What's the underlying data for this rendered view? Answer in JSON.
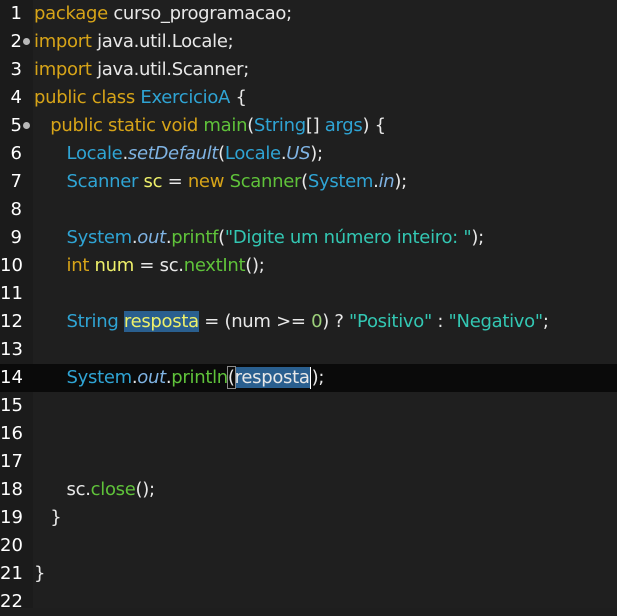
{
  "editor": {
    "lines": [
      {
        "n": "1",
        "segments": [
          {
            "c": "kw",
            "t": "package "
          },
          {
            "c": "plain",
            "t": "curso_programacao;"
          }
        ]
      },
      {
        "n": "2",
        "fold": true,
        "segments": [
          {
            "c": "kw",
            "t": "import "
          },
          {
            "c": "plain",
            "t": "java.util.Locale;"
          }
        ]
      },
      {
        "n": "3",
        "segments": [
          {
            "c": "kw",
            "t": "import "
          },
          {
            "c": "plain",
            "t": "java.util.Scanner;"
          }
        ]
      },
      {
        "n": "4",
        "segments": [
          {
            "c": "kw",
            "t": "public class "
          },
          {
            "c": "ty",
            "t": "ExercicioA"
          },
          {
            "c": "plain",
            "t": " {"
          }
        ]
      },
      {
        "n": "5",
        "fold": true,
        "segments": [
          {
            "c": "plain",
            "t": "   "
          },
          {
            "c": "kw",
            "t": "public static void "
          },
          {
            "c": "fn",
            "t": "main"
          },
          {
            "c": "plain",
            "t": "("
          },
          {
            "c": "ty",
            "t": "String"
          },
          {
            "c": "plain",
            "t": "[] "
          },
          {
            "c": "ty",
            "t": "args"
          },
          {
            "c": "plain",
            "t": ") {"
          }
        ]
      },
      {
        "n": "6",
        "segments": [
          {
            "c": "plain",
            "t": "      "
          },
          {
            "c": "ty",
            "t": "Locale"
          },
          {
            "c": "plain",
            "t": "."
          },
          {
            "c": "fld",
            "t": "setDefault"
          },
          {
            "c": "plain",
            "t": "("
          },
          {
            "c": "ty",
            "t": "Locale"
          },
          {
            "c": "plain",
            "t": "."
          },
          {
            "c": "fld",
            "t": "US"
          },
          {
            "c": "plain",
            "t": ");"
          }
        ]
      },
      {
        "n": "7",
        "segments": [
          {
            "c": "plain",
            "t": "      "
          },
          {
            "c": "ty",
            "t": "Scanner "
          },
          {
            "c": "var",
            "t": "sc"
          },
          {
            "c": "plain",
            "t": " = "
          },
          {
            "c": "kw",
            "t": "new "
          },
          {
            "c": "fn",
            "t": "Scanner"
          },
          {
            "c": "plain",
            "t": "("
          },
          {
            "c": "ty",
            "t": "System"
          },
          {
            "c": "plain",
            "t": "."
          },
          {
            "c": "fld",
            "t": "in"
          },
          {
            "c": "plain",
            "t": ");"
          }
        ]
      },
      {
        "n": "8",
        "segments": []
      },
      {
        "n": "9",
        "segments": [
          {
            "c": "plain",
            "t": "      "
          },
          {
            "c": "ty",
            "t": "System"
          },
          {
            "c": "plain",
            "t": "."
          },
          {
            "c": "fld",
            "t": "out"
          },
          {
            "c": "plain",
            "t": "."
          },
          {
            "c": "fn",
            "t": "printf"
          },
          {
            "c": "plain",
            "t": "("
          },
          {
            "c": "str",
            "t": "\"Digite um número inteiro: \""
          },
          {
            "c": "plain",
            "t": ");"
          }
        ]
      },
      {
        "n": "10",
        "segments": [
          {
            "c": "plain",
            "t": "      "
          },
          {
            "c": "kw",
            "t": "int "
          },
          {
            "c": "var",
            "t": "num"
          },
          {
            "c": "plain",
            "t": " = "
          },
          {
            "c": "plain",
            "t": "sc."
          },
          {
            "c": "fn",
            "t": "nextInt"
          },
          {
            "c": "plain",
            "t": "();"
          }
        ]
      },
      {
        "n": "11",
        "segments": []
      },
      {
        "n": "12",
        "segments": [
          {
            "c": "plain",
            "t": "      "
          },
          {
            "c": "ty",
            "t": "String "
          },
          {
            "c": "var hl",
            "t": "resposta"
          },
          {
            "c": "plain",
            "t": " = (num >= "
          },
          {
            "c": "num",
            "t": "0"
          },
          {
            "c": "plain",
            "t": ") ? "
          },
          {
            "c": "str",
            "t": "\"Positivo\""
          },
          {
            "c": "plain",
            "t": " : "
          },
          {
            "c": "str",
            "t": "\"Negativo\""
          },
          {
            "c": "plain",
            "t": ";"
          }
        ]
      },
      {
        "n": "13",
        "segments": []
      },
      {
        "n": "14",
        "current": true,
        "segments": [
          {
            "c": "plain",
            "t": "      "
          },
          {
            "c": "ty",
            "t": "System"
          },
          {
            "c": "plain",
            "t": "."
          },
          {
            "c": "fld",
            "t": "out"
          },
          {
            "c": "plain",
            "t": "."
          },
          {
            "c": "fn",
            "t": "println"
          },
          {
            "c": "plain bracket-box",
            "t": "("
          },
          {
            "c": "plain hl",
            "t": "resposta"
          },
          {
            "c": "cursor",
            "t": ""
          },
          {
            "c": "plain",
            "t": ");"
          }
        ]
      },
      {
        "n": "15",
        "segments": []
      },
      {
        "n": "16",
        "segments": []
      },
      {
        "n": "17",
        "segments": []
      },
      {
        "n": "18",
        "segments": [
          {
            "c": "plain",
            "t": "      "
          },
          {
            "c": "plain",
            "t": "sc."
          },
          {
            "c": "fn",
            "t": "close"
          },
          {
            "c": "plain",
            "t": "();"
          }
        ]
      },
      {
        "n": "19",
        "segments": [
          {
            "c": "plain",
            "t": "   }"
          }
        ]
      },
      {
        "n": "20",
        "segments": []
      },
      {
        "n": "21",
        "segments": [
          {
            "c": "plain",
            "t": "}"
          }
        ]
      },
      {
        "n": "22",
        "segments": []
      }
    ]
  },
  "colors": {
    "background": "#1f1f1f",
    "keyword": "#d7a418",
    "type": "#2fa4d4",
    "method": "#5fc23a",
    "string": "#33c7b3",
    "static_field": "#7fb3e3",
    "local_var": "#eef06a",
    "selection": "#2a5f8f",
    "current_line": "#0a0a0a"
  }
}
